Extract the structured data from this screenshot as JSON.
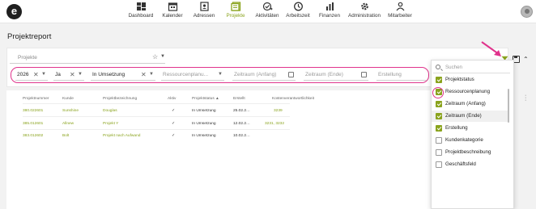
{
  "nav": {
    "items": [
      {
        "label": "Dashboard"
      },
      {
        "label": "Kalender"
      },
      {
        "label": "Adressen"
      },
      {
        "label": "Projekte"
      },
      {
        "label": "Aktivitäten"
      },
      {
        "label": "Arbeitszeit"
      },
      {
        "label": "Finanzen"
      },
      {
        "label": "Administration"
      },
      {
        "label": "Mitarbeiter"
      }
    ],
    "active": "Projekte",
    "accent_color": "#8aa31d",
    "logo_text": "e"
  },
  "page": {
    "title": "Projektreport"
  },
  "filters": {
    "project_placeholder": "Projekte",
    "year": "2026",
    "flag": "Ja",
    "status": "In Umsetzung",
    "resource_placeholder": "Ressourcenplanu...",
    "start_placeholder": "Zeitraum (Anfang)",
    "end_placeholder": "Zeitraum (Ende)",
    "creation_placeholder": "Erstellung"
  },
  "table": {
    "headers": [
      "Projektnummer",
      "Kunde",
      "Projektbezeichnung",
      "Aktiv",
      "Projektstatus ▲",
      "Erstellt",
      "Kostenverantwortlichkeit"
    ],
    "rows": [
      [
        "380.022601",
        "Sunshine",
        "Douglas",
        "✓",
        "In Umsetzung",
        "25.02.2…",
        "3239"
      ],
      [
        "385.012601",
        "Allnew",
        "Projekt Y",
        "✓",
        "In Umsetzung",
        "12.02.2…",
        "3231, 3232"
      ],
      [
        "383.012602",
        "Bolt",
        "Projekt nach Aufwand",
        "✓",
        "In Umsetzung",
        "10.02.2…",
        ""
      ]
    ]
  },
  "column_menu": {
    "search_placeholder": "Suchen",
    "items": [
      {
        "label": "Projektstatus",
        "checked": true
      },
      {
        "label": "Ressourcenplanung",
        "checked": true
      },
      {
        "label": "Zeitraum (Anfang)",
        "checked": true
      },
      {
        "label": "Zeitraum (Ende)",
        "checked": true
      },
      {
        "label": "Erstellung",
        "checked": true
      },
      {
        "label": "Kundenkategorie",
        "checked": false
      },
      {
        "label": "Projektbeschreibung",
        "checked": false
      },
      {
        "label": "Geschäftsfeld",
        "checked": false
      }
    ]
  },
  "colors": {
    "highlight": "#e0338c",
    "green": "#8aa31d"
  }
}
